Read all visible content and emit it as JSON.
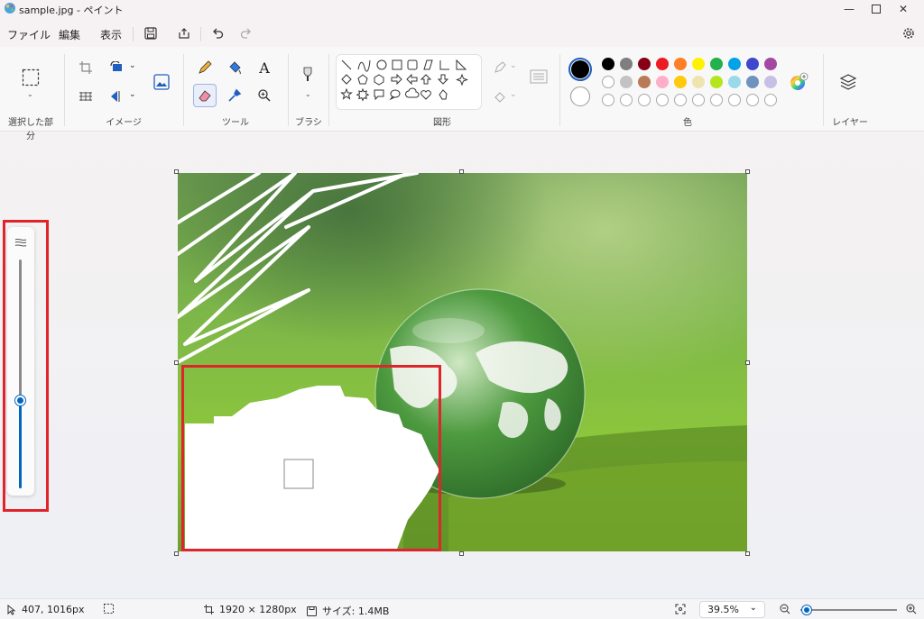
{
  "window": {
    "title": "sample.jpg - ペイント"
  },
  "menu": {
    "file": "ファイル",
    "edit": "編集",
    "view": "表示"
  },
  "ribbon": {
    "groups": {
      "selection": "選択した部分",
      "image": "イメージ",
      "tools": "ツール",
      "brush": "ブラシ",
      "shapes": "図形",
      "colors": "色",
      "layers": "レイヤー"
    },
    "palette": {
      "current_primary": "#000000",
      "current_secondary": "#ffffff",
      "row1": [
        "#000000",
        "#7f7f7f",
        "#880015",
        "#ed1c24",
        "#ff7f27",
        "#fff200",
        "#22b14c",
        "#00a2e8",
        "#3f48cc",
        "#a349a4"
      ],
      "row2": [
        "#ffffff",
        "#c3c3c3",
        "#b97a57",
        "#ffaec9",
        "#ffc90e",
        "#efe4b0",
        "#b5e61d",
        "#99d9ea",
        "#7092be",
        "#c8bfe7"
      ]
    }
  },
  "status": {
    "cursor": "407, 1016px",
    "dimensions": "1920 × 1280px",
    "size": "サイズ: 1.4MB",
    "zoom": "39.5%",
    "zoom_slider_level": 0.07
  },
  "brush_size_level": 0.38,
  "colors": {
    "accent": "#0067c0",
    "highlight": "#e0242b"
  }
}
